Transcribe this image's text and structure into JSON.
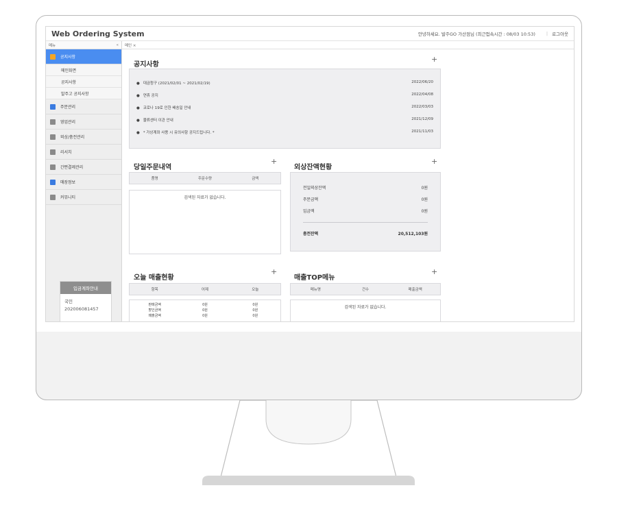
{
  "app": {
    "title": "Web Ordering System",
    "greeting": "안녕하세요. 발주GO 가산점님 (최근접속시간 : 08/03 10:53)",
    "logout": "로그아웃"
  },
  "sidebar": {
    "header": "메뉴",
    "collapse": "«",
    "items": [
      {
        "label": "공지사항",
        "color": "#f5a623"
      },
      {
        "label": "주문관리",
        "color": "#3a7be0"
      },
      {
        "label": "영업관리",
        "color": "#8a8a8a"
      },
      {
        "label": "외상/충전관리",
        "color": "#8a8a8a"
      },
      {
        "label": "리서치",
        "color": "#8a8a8a"
      },
      {
        "label": "간편결제관리",
        "color": "#8a8a8a"
      },
      {
        "label": "매장정보",
        "color": "#3a7be0"
      },
      {
        "label": "커뮤니티",
        "color": "#8a8a8a"
      }
    ],
    "subitems": [
      "메인화면",
      "공지사항",
      "발주고 공지사항"
    ]
  },
  "account": {
    "title": "입금계좌안내",
    "bank": "국민",
    "number": "202006081457"
  },
  "tabs": {
    "main": "메인 ×"
  },
  "notice": {
    "title": "공지사항",
    "plus": "+",
    "rows": [
      {
        "text": "대금청구 (2021/02/01 ~ 2021/02/19)",
        "date": "2022/06/20"
      },
      {
        "text": "연휴 공지",
        "date": "2022/04/08"
      },
      {
        "text": "코로나 19로 인한 배송일 안내",
        "date": "2022/03/03"
      },
      {
        "text": "물류센터 이관 안내",
        "date": "2021/12/09"
      },
      {
        "text": "* 가상계좌 사용 시 유의사항 공지드립니다. *",
        "date": "2021/11/03"
      }
    ]
  },
  "daily_orders": {
    "title": "당일주문내역",
    "plus": "+",
    "columns": [
      "품명",
      "주문수량",
      "금액"
    ],
    "empty": "검색된 자료가 없습니다."
  },
  "balance": {
    "title": "외상잔액현황",
    "plus": "+",
    "rows": [
      {
        "label": "전일외상잔액",
        "value": "0원"
      },
      {
        "label": "주문금액",
        "value": "0원"
      },
      {
        "label": "입금액",
        "value": "0원"
      }
    ],
    "total_label": "총전잔액",
    "total_value": "20,512,103원"
  },
  "today_sales": {
    "title": "오늘 매출현황",
    "plus": "+",
    "columns": [
      "항목",
      "어제",
      "오늘"
    ],
    "rows": [
      {
        "item": "판매금액",
        "yesterday": "0원",
        "today": "0원"
      },
      {
        "item": "할인금액",
        "yesterday": "0원",
        "today": "0원"
      },
      {
        "item": "매출금액",
        "yesterday": "0원",
        "today": "0원"
      }
    ]
  },
  "top_menu": {
    "title": "매출TOP메뉴",
    "plus": "+",
    "columns": [
      "메뉴명",
      "건수",
      "매출금액"
    ],
    "empty": "검색된 자료가 없습니다."
  }
}
